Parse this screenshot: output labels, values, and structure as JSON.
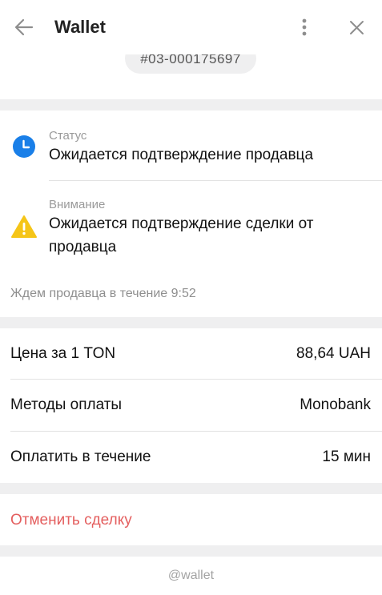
{
  "header": {
    "title": "Wallet"
  },
  "deal": {
    "number": "#03-000175697"
  },
  "status": {
    "label": "Статус",
    "value": "Ожидается подтверждение продавца"
  },
  "attention": {
    "label": "Внимание",
    "value": "Ожидается подтверждение сделки от продавца"
  },
  "wait_text": "Ждем продавца в течение 9:52",
  "details": [
    {
      "key": "Цена за 1 TON",
      "value": "88,64 UAH"
    },
    {
      "key": "Методы оплаты",
      "value": "Monobank"
    },
    {
      "key": "Оплатить в течение",
      "value": "15 мин"
    }
  ],
  "cancel_label": "Отменить сделку",
  "footer_text": "@wallet",
  "colors": {
    "accent_blue": "#1a7fe8",
    "warning_yellow": "#f5c518",
    "danger_red": "#e45f5f",
    "background": "#efeff0"
  },
  "icons": {
    "back": "arrow-left-icon",
    "menu": "more-vertical-icon",
    "close": "close-icon",
    "status": "clock-icon",
    "attention": "warning-icon"
  }
}
